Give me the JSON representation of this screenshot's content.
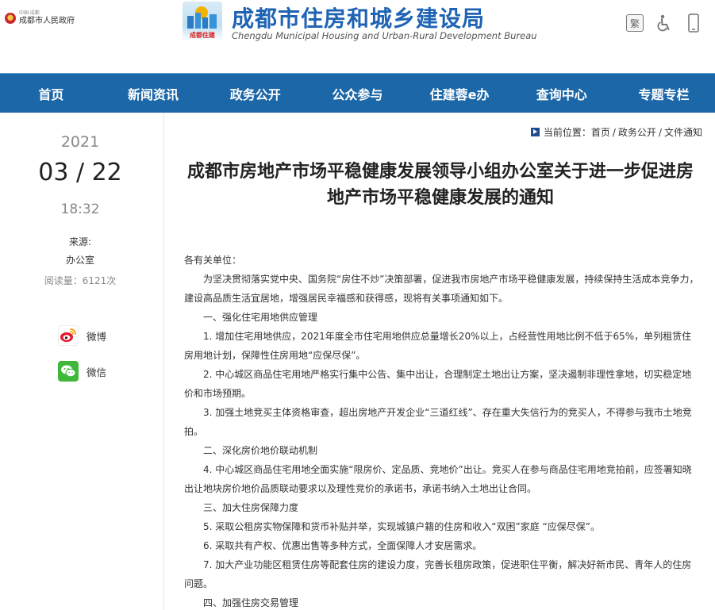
{
  "header": {
    "gov_logo_small": "中国·成都",
    "gov_logo_big": "成都市人民政府",
    "bureau_logo_tag": "成都住建",
    "bureau_title": "成都市住房和城乡建设局",
    "bureau_subtitle": "Chengdu Municipal Housing and Urban-Rural Development Bureau",
    "tools": {
      "traditional": "繁",
      "accessibility_icon": "wheelchair-icon",
      "mobile_icon": "mobile-phone-icon"
    }
  },
  "nav": {
    "items": [
      {
        "label": "首页"
      },
      {
        "label": "新闻资讯"
      },
      {
        "label": "政务公开"
      },
      {
        "label": "公众参与"
      },
      {
        "label": "住建蓉e办"
      },
      {
        "label": "查询中心"
      },
      {
        "label": "专题专栏"
      }
    ],
    "background": "#1c67a8"
  },
  "sidebar": {
    "year": "2021",
    "date": "03 / 22",
    "time": "18:32",
    "source_label": "来源:",
    "source_value": "办公室",
    "views": "阅读量：6121次",
    "share": [
      {
        "label": "微博",
        "icon": "weibo-icon"
      },
      {
        "label": "微信",
        "icon": "wechat-icon"
      }
    ]
  },
  "breadcrumb": {
    "prefix": "当前位置：",
    "items": [
      "首页",
      "政务公开",
      "文件通知"
    ],
    "separator": "/"
  },
  "article": {
    "title": "成都市房地产市场平稳健康发展领导小组办公室关于进一步促进房地产市场平稳健康发展的通知",
    "paragraphs": [
      "各有关单位：",
      "为坚决贯彻落实党中央、国务院“房住不炒”决策部署，促进我市房地产市场平稳健康发展，持续保持生活成本竞争力，建设高品质生活宜居地，增强居民幸福感和获得感，现将有关事项通知如下。",
      "一、强化住宅用地供应管理",
      "1. 增加住宅用地供应，2021年度全市住宅用地供应总量增长20%以上，占经营性用地比例不低于65%，单列租赁住房用地计划，保障性住房用地“应保尽保”。",
      "2. 中心城区商品住宅用地严格实行集中公告、集中出让，合理制定土地出让方案，坚决遏制非理性拿地，切实稳定地价和市场预期。",
      "3. 加强土地竞买主体资格审查，超出房地产开发企业“三道红线”、存在重大失信行为的竞买人，不得参与我市土地竞拍。",
      "二、深化房价地价联动机制",
      "4. 中心城区商品住宅用地全面实施“限房价、定品质、竞地价”出让。竞买人在参与商品住宅用地竞拍前，应签署知晓出让地块房价地价品质联动要求以及理性竞价的承诺书，承诺书纳入土地出让合同。",
      "三、加大住房保障力度",
      "5. 采取公租房实物保障和货币补贴并举，实现城镇户籍的住房和收入“双困”家庭 “应保尽保”。",
      "6. 采取共有产权、优惠出售等多种方式，全面保障人才安居需求。",
      "7. 加大产业功能区租赁住房等配套住房的建设力度，完善长租房政策，促进职住平衡，解决好新市民、青年人的住房问题。",
      "四、加强住房交易管理"
    ]
  }
}
